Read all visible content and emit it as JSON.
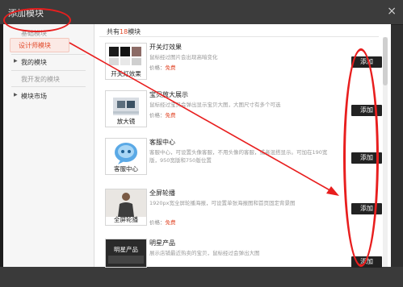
{
  "window": {
    "title": "添加模块",
    "close_glyph": "×"
  },
  "sidebar": {
    "items": [
      {
        "label": "基础模块",
        "muted": true
      },
      {
        "label": "设计师模块",
        "selected": true
      },
      {
        "label": "我的模块"
      },
      {
        "label": "我开发的模块",
        "muted": true
      },
      {
        "label": "模块市场"
      }
    ]
  },
  "main": {
    "count_prefix": "共有",
    "count_num": "18",
    "count_suffix": "模块",
    "price_label": "价格：",
    "free_label": "免费",
    "add_label": "添加",
    "modules": [
      {
        "name": "开关灯效果",
        "caption": "开关灯效果",
        "desc": "鼠标经过图片会出现高暗变化"
      },
      {
        "name": "宝贝放大展示",
        "caption": "放大镜",
        "desc": "鼠标经过宝贝会弹出显示宝贝大图，大图尺寸有多个可选"
      },
      {
        "name": "客服中心",
        "caption": "客服中心",
        "desc": "客服中心，可设置头像客服，不用头像的客服，或者混搭显示。可加在190宽版，950宽版和750版位置"
      },
      {
        "name": "全屏轮播",
        "caption": "全屏轮播",
        "desc": "1920px宽全屏轮播海报，可设置单张海报图和首页固定背景图"
      },
      {
        "name": "明星产品",
        "caption": "明星产品",
        "desc": "展示店铺最近热卖的宝贝，鼠标经过会弹出大图"
      }
    ]
  },
  "annotation_color": "#e81e1e",
  "accent_color": "#e24a2b"
}
